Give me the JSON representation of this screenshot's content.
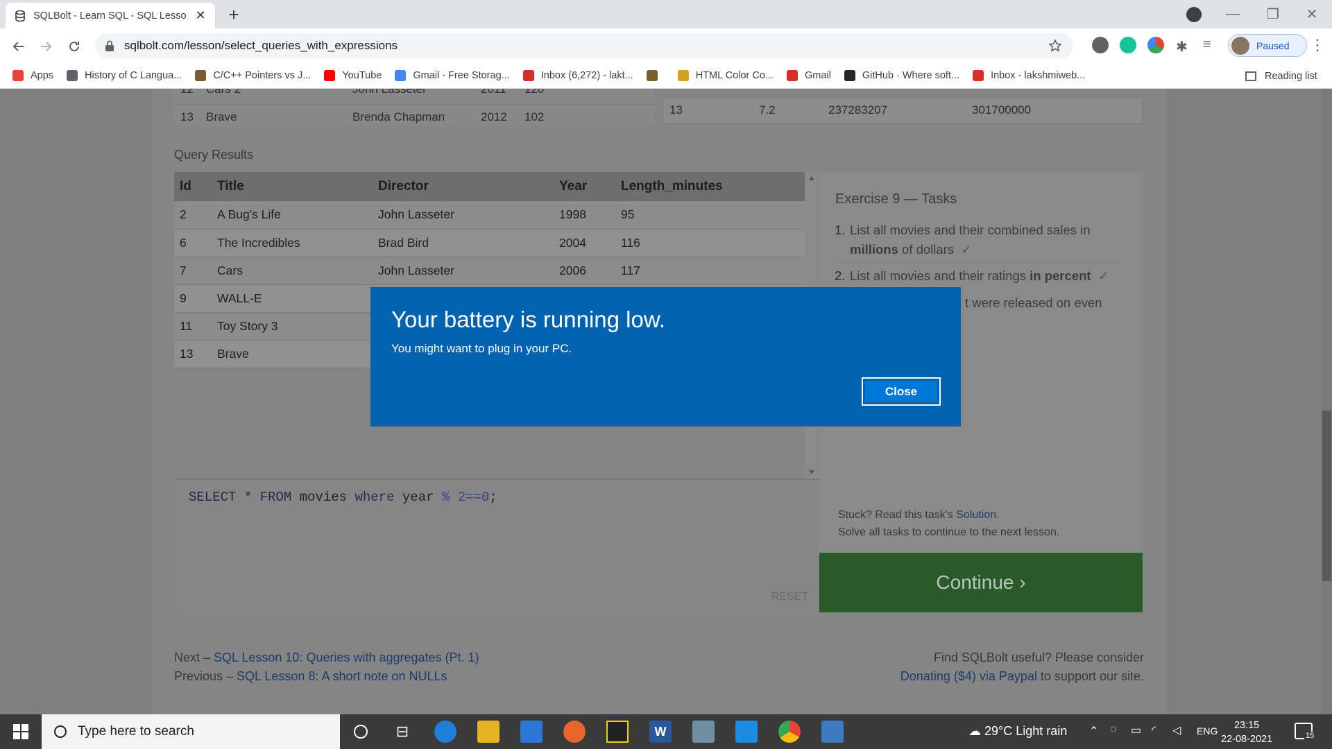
{
  "browser": {
    "tab_title": "SQLBolt - Learn SQL - SQL Lesso",
    "url": "sqlbolt.com/lesson/select_queries_with_expressions",
    "profile_label": "Paused",
    "reading_list": "Reading list",
    "bookmarks": [
      {
        "label": "Apps",
        "icon": "apps-grid-icon",
        "color": "#ea4335"
      },
      {
        "label": "History of C Langua...",
        "icon": "globe-icon",
        "color": "#5f6368"
      },
      {
        "label": "C/C++ Pointers vs J...",
        "icon": "site-icon",
        "color": "#7a5c2e"
      },
      {
        "label": "YouTube",
        "icon": "youtube-icon",
        "color": "#ff0000"
      },
      {
        "label": "Gmail - Free Storag...",
        "icon": "google-icon",
        "color": "#4285f4"
      },
      {
        "label": "Inbox (6,272) - lakt...",
        "icon": "gmail-icon",
        "color": "#d93025"
      },
      {
        "label": "",
        "icon": "site-grid-icon",
        "color": "#7a5c2e"
      },
      {
        "label": "HTML Color Co...",
        "icon": "palette-icon",
        "color": "#d6a01a"
      },
      {
        "label": "Gmail",
        "icon": "gmail-icon",
        "color": "#d93025"
      },
      {
        "label": "GitHub · Where soft...",
        "icon": "github-icon",
        "color": "#24292e"
      },
      {
        "label": "Inbox - lakshmiweb...",
        "icon": "gmail-icon",
        "color": "#d93025"
      }
    ]
  },
  "top_partial": {
    "rows_left": [
      {
        "id": "12",
        "title": "Cars 2",
        "director": "John Lasseter",
        "year": "2011",
        "length": "120"
      },
      {
        "id": "13",
        "title": "Brave",
        "director": "Brenda Chapman",
        "year": "2012",
        "length": "102"
      }
    ],
    "row_right": {
      "id": "13",
      "rating": "7.2",
      "domestic": "237283207",
      "international": "301700000"
    }
  },
  "query_results": {
    "label": "Query Results",
    "headers": [
      "Id",
      "Title",
      "Director",
      "Year",
      "Length_minutes"
    ],
    "rows": [
      [
        "2",
        "A Bug's Life",
        "John Lasseter",
        "1998",
        "95"
      ],
      [
        "6",
        "The Incredibles",
        "Brad Bird",
        "2004",
        "116"
      ],
      [
        "7",
        "Cars",
        "John Lasseter",
        "2006",
        "117"
      ],
      [
        "9",
        "WALL-E",
        "",
        "",
        ""
      ],
      [
        "11",
        "Toy Story 3",
        "",
        "",
        ""
      ],
      [
        "13",
        "Brave",
        "",
        "",
        ""
      ]
    ]
  },
  "editor": {
    "sql_select": "SELECT",
    "sql_star": " * ",
    "sql_from": "FROM",
    "sql_table": " movies ",
    "sql_where": "where",
    "sql_col": " year ",
    "sql_expr": "% 2==0",
    "sql_end": ";",
    "reset": "RESET"
  },
  "exercise": {
    "title": "Exercise 9 — Tasks",
    "task1_a": "List all movies and their combined sales in",
    "task1_b": "millions",
    "task1_c": " of dollars",
    "task2_a": "List all movies and their ratings ",
    "task2_b": "in percent",
    "task3_partial": "t were released on even",
    "check": "✓",
    "stuck_prefix": "Stuck? Read this task's ",
    "stuck_link": "Solution",
    "stuck_suffix": ".",
    "solve_all": "Solve all tasks to continue to the next lesson.",
    "continue": "Continue ›"
  },
  "footer": {
    "next_prefix": "Next – ",
    "next_link": "SQL Lesson 10: Queries with aggregates (Pt. 1)",
    "prev_prefix": "Previous – ",
    "prev_link": "SQL Lesson 8: A short note on NULLs",
    "useful": "Find SQLBolt useful? Please consider",
    "donate_link": "Donating ($4) via Paypal",
    "donate_suffix": " to support our site."
  },
  "dialog": {
    "title": "Your battery is running low.",
    "message": "You might want to plug in your PC.",
    "close": "Close"
  },
  "taskbar": {
    "search_placeholder": "Type here to search",
    "weather": "29°C  Light rain",
    "lang": "ENG",
    "time": "23:15",
    "date": "22-08-2021",
    "notification_count": "15"
  },
  "colors": {
    "dialog_blue": "#0063b1",
    "continue_green": "#2a5a29"
  }
}
